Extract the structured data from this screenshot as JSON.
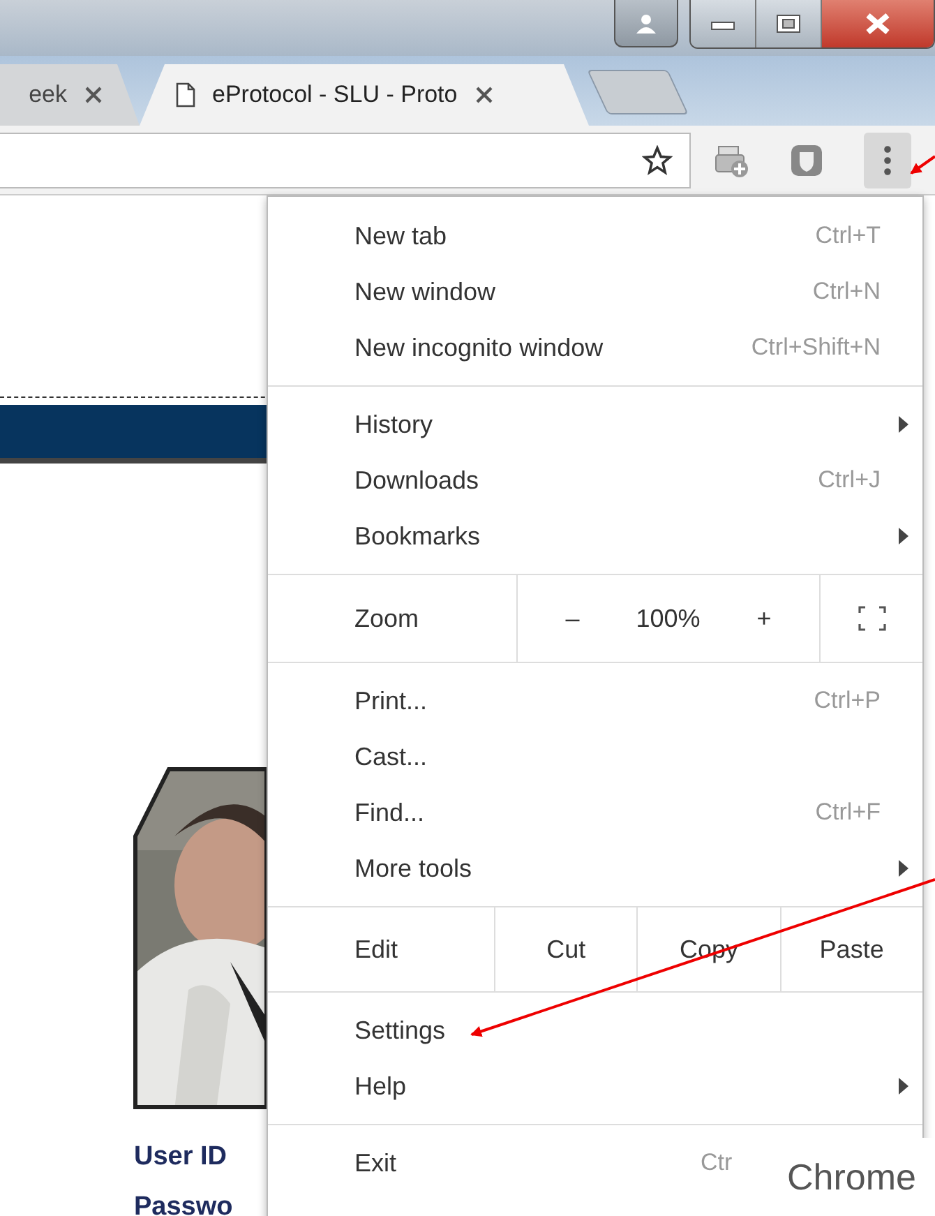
{
  "tabs": [
    {
      "label": "eek",
      "selected": false
    },
    {
      "label": "eProtocol - SLU - Proto",
      "selected": true
    }
  ],
  "toolbar": {
    "menu_open": true
  },
  "page": {
    "labels": [
      "User ID",
      "Passwo"
    ]
  },
  "menu": {
    "sections": [
      [
        {
          "kind": "item",
          "label": "New tab",
          "shortcut": "Ctrl+T",
          "submenu": false
        },
        {
          "kind": "item",
          "label": "New window",
          "shortcut": "Ctrl+N",
          "submenu": false
        },
        {
          "kind": "item",
          "label": "New incognito window",
          "shortcut": "Ctrl+Shift+N",
          "submenu": false
        }
      ],
      [
        {
          "kind": "item",
          "label": "History",
          "submenu": true
        },
        {
          "kind": "item",
          "label": "Downloads",
          "shortcut": "Ctrl+J",
          "submenu": false
        },
        {
          "kind": "item",
          "label": "Bookmarks",
          "submenu": true
        }
      ],
      [
        {
          "kind": "zoom",
          "label": "Zoom",
          "minus": "–",
          "value": "100%",
          "plus": "+"
        }
      ],
      [
        {
          "kind": "item",
          "label": "Print...",
          "shortcut": "Ctrl+P",
          "submenu": false
        },
        {
          "kind": "item",
          "label": "Cast...",
          "submenu": false
        },
        {
          "kind": "item",
          "label": "Find...",
          "shortcut": "Ctrl+F",
          "submenu": false
        },
        {
          "kind": "item",
          "label": "More tools",
          "submenu": true
        }
      ],
      [
        {
          "kind": "edit",
          "label": "Edit",
          "buttons": [
            "Cut",
            "Copy",
            "Paste"
          ]
        }
      ],
      [
        {
          "kind": "item",
          "label": "Settings",
          "submenu": false
        },
        {
          "kind": "item",
          "label": "Help",
          "submenu": true
        }
      ],
      [
        {
          "kind": "item",
          "label": "Exit",
          "shortcut": "Ctr",
          "submenu": false
        }
      ]
    ]
  },
  "overlay_text": "Chrome"
}
